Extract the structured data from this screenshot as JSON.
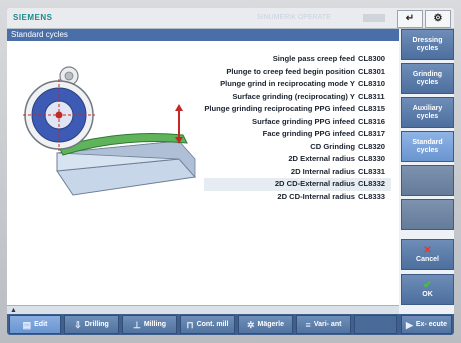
{
  "top_bar": {
    "logo": "SIEMENS",
    "mode_text": "SINUMERIK OPERATE",
    "mode_btn_1": "↵",
    "mode_btn_2": "⚙"
  },
  "panel": {
    "title": "Standard cycles"
  },
  "cycles": [
    {
      "name": "Single pass creep feed",
      "code": "CL8300"
    },
    {
      "name": "Plunge to creep feed begin position",
      "code": "CL8301"
    },
    {
      "name": "Plunge grind in reciprocating mode Y",
      "code": "CL8310"
    },
    {
      "name": "Surface grinding (reciprocating) Y",
      "code": "CL8311"
    },
    {
      "name": "Plunge grinding reciprocating PPG infeed",
      "code": "CL8315"
    },
    {
      "name": "Surface grinding PPG infeed",
      "code": "CL8316"
    },
    {
      "name": "Face grinding PPG infeed",
      "code": "CL8317"
    },
    {
      "name": "CD Grinding",
      "code": "CL8320"
    },
    {
      "name": "2D External radius",
      "code": "CL8330"
    },
    {
      "name": "2D Internal radius",
      "code": "CL8331"
    },
    {
      "name": "2D CD-External radius",
      "code": "CL8332"
    },
    {
      "name": "2D CD-Internal radius",
      "code": "CL8333"
    }
  ],
  "vertical_softkeys": {
    "dressing": "Dressing cycles",
    "grinding": "Grinding cycles",
    "auxiliary": "Auxiliary cycles",
    "standard": "Standard cycles",
    "cancel": "Cancel",
    "ok": "OK"
  },
  "horizontal_softkeys": {
    "edit": "Edit",
    "drilling": "Drilling",
    "milling": "Milling",
    "cont_mill": "Cont. mill",
    "mageria": "Mägerle",
    "variant": "Vari- ant",
    "execute": "Ex- ecute"
  },
  "colors": {
    "accent": "#4a6fa8",
    "softkey": "#5b7cab",
    "softkey_active": "#7aa3db",
    "cancel_icon": "#d9342b",
    "ok_icon": "#3aa635"
  }
}
